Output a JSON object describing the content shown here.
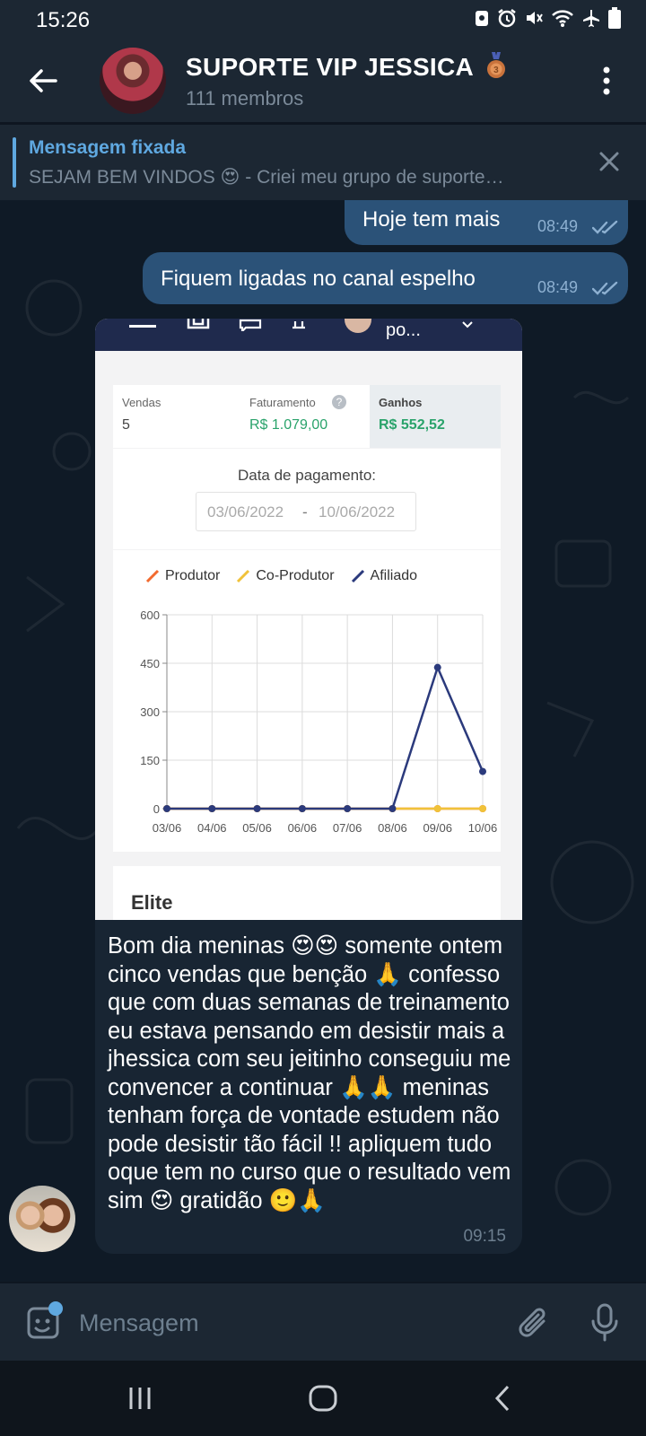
{
  "status_bar": {
    "time": "15:26"
  },
  "header": {
    "title": "SUPORTE VIP JESSICA",
    "members": "111 membros"
  },
  "pinned": {
    "label": "Mensagem fixada",
    "text": "SEJAM BEM VINDOS 😍  - Criei meu grupo de suporte…"
  },
  "messages": [
    {
      "text": "Hoje tem mais",
      "time": "08:49"
    },
    {
      "text": "Fiquem ligadas no canal espelho",
      "time": "08:49"
    }
  ],
  "screenshot": {
    "topbar_text": "po...",
    "stats": [
      {
        "label": "Vendas",
        "value": "5"
      },
      {
        "label": "Faturamento",
        "value": "R$ 1.079,00"
      },
      {
        "label": "Ganhos",
        "value": "R$ 552,52"
      }
    ],
    "date_label": "Data de pagamento:",
    "date_from": "03/06/2022",
    "date_sep": "-",
    "date_to": "10/06/2022",
    "next_card_title": "Elite"
  },
  "chart_data": {
    "type": "line",
    "x": [
      "03/06",
      "04/06",
      "05/06",
      "06/06",
      "07/06",
      "08/06",
      "09/06",
      "10/06"
    ],
    "ylim": [
      0,
      600
    ],
    "yticks": [
      0,
      150,
      300,
      450,
      600
    ],
    "legend_position": "top",
    "grid": true,
    "series": [
      {
        "name": "Produtor",
        "color": "#f26a2f",
        "values": [
          0,
          0,
          0,
          0,
          0,
          0,
          0,
          0
        ]
      },
      {
        "name": "Co-Produtor",
        "color": "#f0c23a",
        "values": [
          0,
          0,
          0,
          0,
          0,
          0,
          0,
          0
        ]
      },
      {
        "name": "Afiliado",
        "color": "#2b3a7c",
        "values": [
          0,
          0,
          0,
          0,
          0,
          0,
          437,
          115
        ]
      }
    ]
  },
  "incoming": {
    "text": "Bom dia meninas 😍😍 somente ontem cinco vendas que benção 🙏 confesso que com duas semanas de treinamento eu estava pensando em desistir mais a jhessica com seu jeitinho conseguiu me convencer a continuar 🙏🙏 meninas tenham força de vontade estudem não pode desistir tão fácil !! apliquem tudo oque tem no curso que o resultado vem sim 😍 gratidão 🙂🙏",
    "time": "09:15"
  },
  "composer": {
    "placeholder": "Mensagem"
  }
}
